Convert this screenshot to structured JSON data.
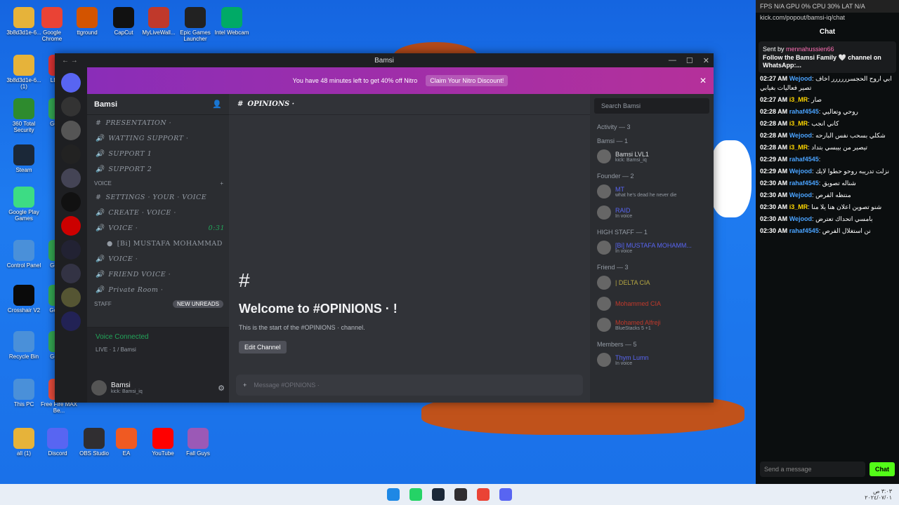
{
  "desktop": {
    "icons": [
      "3b8d3d1e-6...",
      "Google Chrome",
      "ttground",
      "CapCut",
      "MyLiveWall...",
      "Epic Games Launcher",
      "Intel Webcam",
      "3b8d3d1e-6... (1)",
      "LEAFp",
      "360 Total Security",
      "Google",
      "Steam",
      "Google Play Games",
      "Control Panel",
      "Google",
      "Crosshair V2",
      "Goo Sh",
      "Recycle Bin",
      "Google",
      "This PC",
      "Free Fire MAX Be...",
      "all (1)",
      "Discord",
      "OBS Studio",
      "EA",
      "YouTube",
      "Fall Guys"
    ]
  },
  "discord": {
    "title": "Bamsi",
    "nitro": {
      "text": "You have 48 minutes left to get 40% off Nitro",
      "cta": "Claim Your Nitro Discount!"
    },
    "server_name": "Bamsi",
    "channels": [
      {
        "name": "PRESENTATION ·",
        "type": "text"
      },
      {
        "name": "WATTING SUPPORT ·",
        "type": "voice"
      },
      {
        "name": "SUPPORT 1",
        "type": "voice"
      },
      {
        "name": "SUPPORT 2",
        "type": "voice"
      }
    ],
    "voice_cat": "VOICE",
    "voice_channels": [
      {
        "name": "SETTINGS · YOUR · VOICE",
        "type": "text"
      },
      {
        "name": "CREATE · VOICE ·",
        "type": "voice"
      },
      {
        "name": "VOICE ·",
        "type": "voice",
        "extra": "1",
        "time": "0:31"
      },
      {
        "name": "[Bi] MUSTAFA MOHAMMAD",
        "type": "user"
      },
      {
        "name": "VOICE ·",
        "type": "voice",
        "extra": "2"
      },
      {
        "name": "FRIEND VOICE ·",
        "type": "voice"
      },
      {
        "name": "Private Room ·",
        "type": "voice"
      }
    ],
    "staff_cat": "STAFF",
    "new_unreads": "NEW UNREADS",
    "voice_connected": "Voice Connected",
    "voice_sub": "LIVE · 1 / Bamsi",
    "user_name": "Bamsi",
    "user_status": "kick: Bamsi_iq",
    "channel": "OPINIONS ·",
    "search": "Search Bamsi",
    "welcome": "Welcome to #OPINIONS · !",
    "start_text": "This is the start of the #OPINIONS · channel.",
    "edit_channel": "Edit Channel",
    "message_placeholder": "Message #OPINIONS ·",
    "activity": "Activity — 3",
    "groups": [
      {
        "title": "Bamsi — 1",
        "members": [
          {
            "name": "Bamsi",
            "tag": "LVL1",
            "sub": "kick: Bamsi_iq",
            "color": "#dbdee1"
          }
        ]
      },
      {
        "title": "Founder — 2",
        "members": [
          {
            "name": "",
            "tag": "MT",
            "sub": "what he's dead he never die",
            "color": "#5865f2"
          },
          {
            "name": "",
            "tag": "RAID",
            "sub": "In voice",
            "color": "#5865f2"
          }
        ]
      },
      {
        "title": "HIGH STAFF — 1",
        "members": [
          {
            "name": "[Bi] MUSTAFA MOHAMM...",
            "tag": "",
            "sub": "In voice",
            "color": "#5865f2"
          }
        ]
      },
      {
        "title": "Friend — 3",
        "members": [
          {
            "name": "| DELTA",
            "tag": "CIA",
            "sub": "",
            "color": "#b5a642"
          },
          {
            "name": "Mohammed",
            "tag": "CIA",
            "sub": "",
            "color": "#c0392b"
          },
          {
            "name": "Mohamed Alfreji",
            "tag": "",
            "sub": "BlueStacks 5 +1",
            "color": "#c0392b"
          }
        ]
      },
      {
        "title": "Members — 5",
        "members": [
          {
            "name": "Thym Lumn",
            "tag": "",
            "sub": "In voice",
            "color": "#5865f2"
          }
        ]
      }
    ]
  },
  "kick": {
    "stats": "FPS N/A  GPU 0%  CPU 30%  LAT N/A",
    "url": "kick.com/popout/bamsi-iq/chat",
    "header": "Chat",
    "pinned_by": "Sent by",
    "pinned_user": "mennahussien66",
    "pinned_text": "Follow the Bamsi Family 🤍 channel on WhatsApp:...",
    "messages": [
      {
        "time": "02:27 AM",
        "user": "Wejood",
        "text": "ابي اروح الحجسرررررر اخاف تصير فعاليات بغيابي",
        "color": "#4aa3ff"
      },
      {
        "time": "02:27 AM",
        "user": "i3_MR",
        "text": "صار",
        "color": "#ffd700"
      },
      {
        "time": "02:28 AM",
        "user": "rahaf4545",
        "text": "روحي وتعاليي",
        "color": "#4aa3ff"
      },
      {
        "time": "02:28 AM",
        "user": "i3_MR",
        "text": "كاني انجب",
        "color": "#ffd700"
      },
      {
        "time": "02:28 AM",
        "user": "Wejood",
        "text": "شكلي بسحب نفس البارحه",
        "color": "#4aa3ff"
      },
      {
        "time": "02:28 AM",
        "user": "i3_MR",
        "text": "تيصير من بيبسي بتداد",
        "color": "#ffd700"
      },
      {
        "time": "02:29 AM",
        "user": "rahaf4545",
        "text": "",
        "color": "#4aa3ff"
      },
      {
        "time": "02:29 AM",
        "user": "Wejood",
        "text": "نزلت تدريبه روحو حطوا لايك",
        "color": "#4aa3ff"
      },
      {
        "time": "02:30 AM",
        "user": "rahaf4545",
        "text": "شناله تصويق",
        "color": "#4aa3ff"
      },
      {
        "time": "02:30 AM",
        "user": "Wejood",
        "text": "منتظه الفرص",
        "color": "#4aa3ff"
      },
      {
        "time": "02:30 AM",
        "user": "i3_MR",
        "text": "شنو تصوين اعلان هنا يلا منا",
        "color": "#ffd700"
      },
      {
        "time": "02:30 AM",
        "user": "Wejood",
        "text": "بامسي اتحداك تعترض",
        "color": "#4aa3ff"
      },
      {
        "time": "02:30 AM",
        "user": "rahaf4545",
        "text": "نن استغلال الفرص",
        "color": "#4aa3ff"
      }
    ],
    "send_placeholder": "Send a message",
    "chat_button": "Chat"
  },
  "taskbar": {
    "time": "٣:٠٣ ص",
    "date": "٢٠٢٤/٠٧/٠١"
  }
}
